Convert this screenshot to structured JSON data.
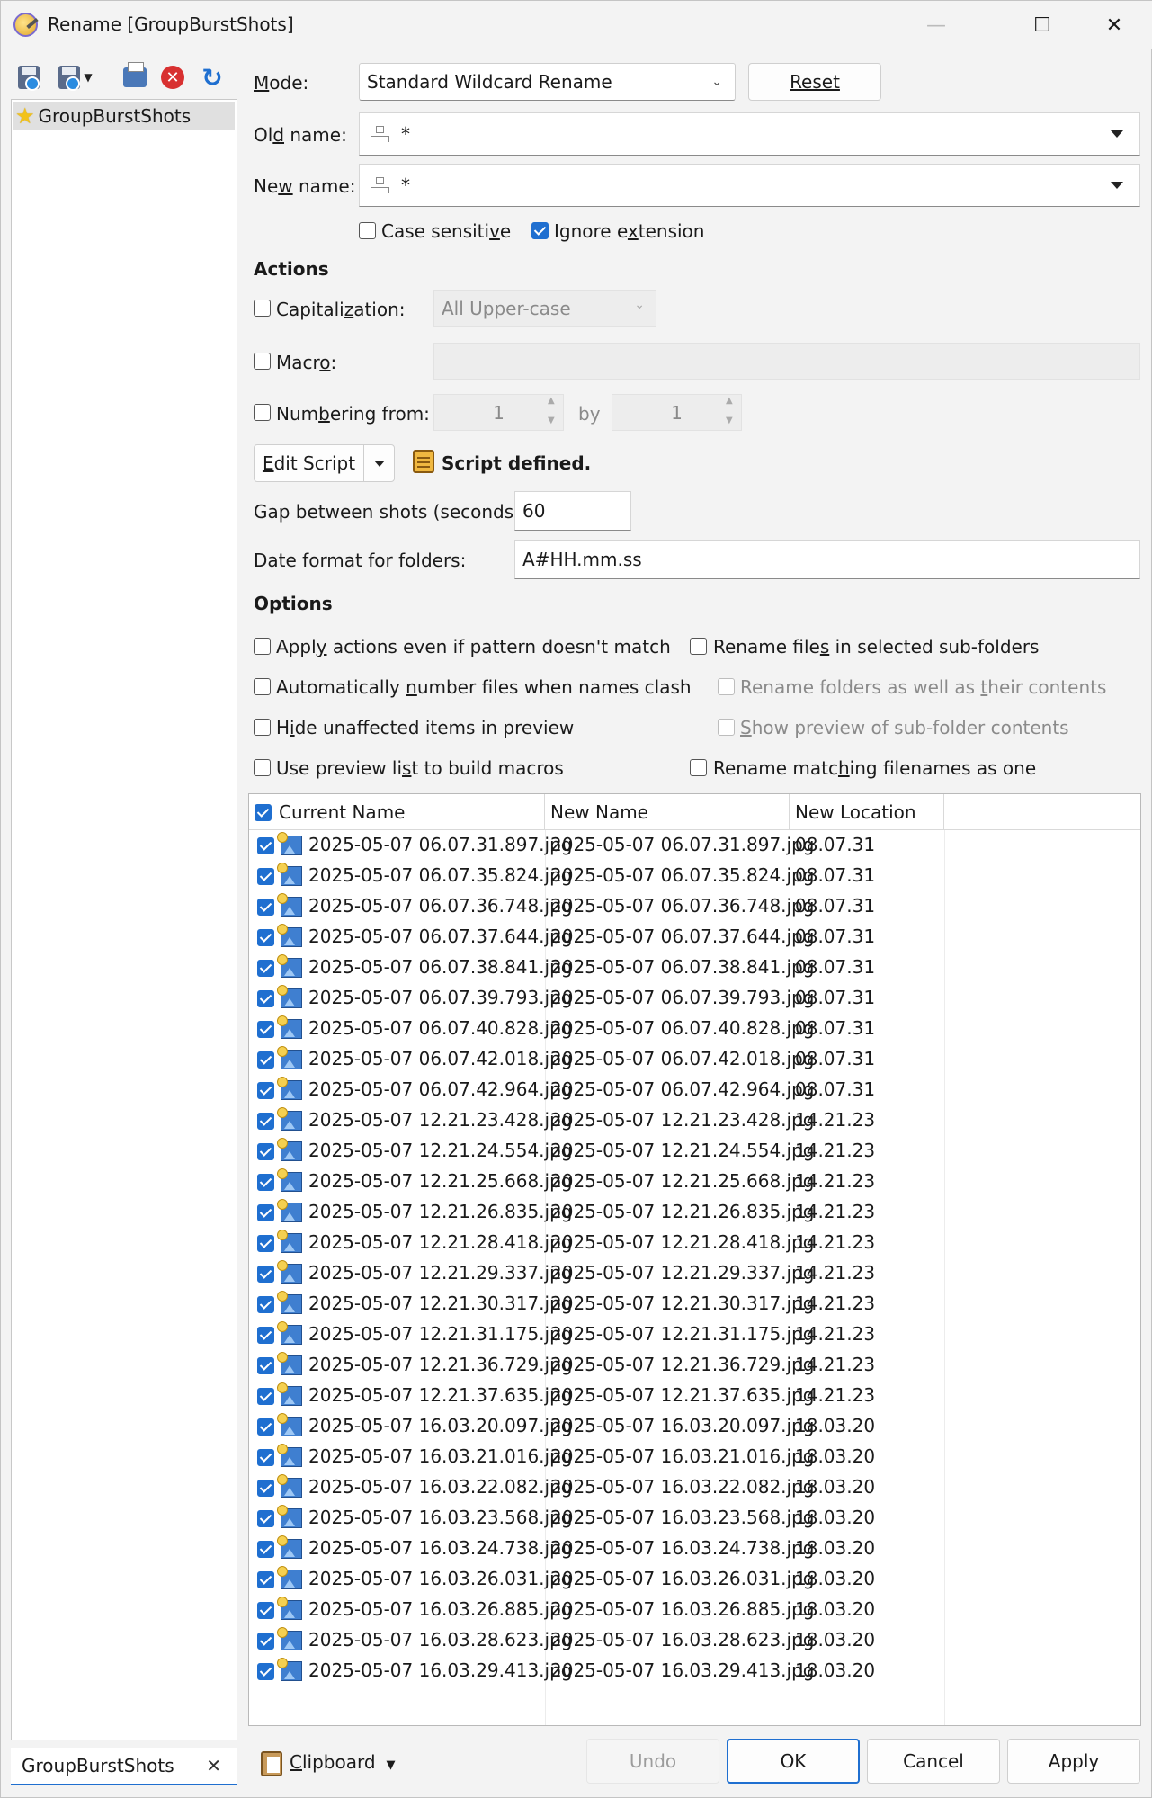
{
  "window": {
    "title": "Rename [GroupBurstShots]"
  },
  "sidebar": {
    "preset": "GroupBurstShots",
    "filter_value": "GroupBurstShots"
  },
  "mode": {
    "label_pre": "",
    "label_u": "M",
    "label_post": "ode:",
    "value": "Standard Wildcard Rename",
    "reset": "Reset"
  },
  "old_name": {
    "label_pre": "Ol",
    "label_u": "d",
    "label_post": " name:",
    "value": "*"
  },
  "new_name": {
    "label_pre": "Ne",
    "label_u": "w",
    "label_post": " name:",
    "value": "*"
  },
  "flags": {
    "case_pre": "Case sensiti",
    "case_u": "v",
    "case_post": "e",
    "ignore_pre": "Ignore e",
    "ignore_u": "x",
    "ignore_post": "tension"
  },
  "actions": {
    "heading": "Actions",
    "cap_pre": "Capitali",
    "cap_u": "z",
    "cap_post": "ation:",
    "cap_value": "All Upper-case",
    "macro_pre": "Macr",
    "macro_u": "o",
    "macro_post": ":",
    "num_pre": "Num",
    "num_u": "b",
    "num_post": "ering from:",
    "num_from": "1",
    "num_by_label": "by",
    "num_by": "1",
    "edit_script_u": "E",
    "edit_script_post": "dit Script",
    "script_status": "Script defined."
  },
  "script_fields": {
    "gap_label": "Gap between shots (seconds):",
    "gap_value": "60",
    "date_label": "Date format for folders:",
    "date_value": "A#HH.mm.ss"
  },
  "options": {
    "heading": "Options",
    "o1_pre": "Appl",
    "o1_u": "y",
    "o1_post": " actions even if pattern doesn't match",
    "o2_pre": "Automatically ",
    "o2_u": "n",
    "o2_post": "umber files when names clash",
    "o3_pre": "H",
    "o3_u": "i",
    "o3_post": "de unaffected items in preview",
    "o4_pre": "Use preview li",
    "o4_u": "s",
    "o4_post": "t to build macros",
    "o5_pre": "Rename file",
    "o5_u": "s",
    "o5_post": " in selected sub-folders",
    "o6_pre": "Rename folders as well as ",
    "o6_u": "t",
    "o6_post": "heir contents",
    "o7_pre": "",
    "o7_u": "S",
    "o7_post": "how preview of sub-folder contents",
    "o8_pre": "Rename matc",
    "o8_u": "h",
    "o8_post": "ing filenames as one"
  },
  "preview": {
    "columns": [
      "Current Name",
      "New Name",
      "New Location"
    ],
    "rows": [
      [
        "2025-05-07 06.07.31.897.jpg",
        "2025-05-07 06.07.31.897.jpg",
        "08.07.31"
      ],
      [
        "2025-05-07 06.07.35.824.jpg",
        "2025-05-07 06.07.35.824.jpg",
        "08.07.31"
      ],
      [
        "2025-05-07 06.07.36.748.jpg",
        "2025-05-07 06.07.36.748.jpg",
        "08.07.31"
      ],
      [
        "2025-05-07 06.07.37.644.jpg",
        "2025-05-07 06.07.37.644.jpg",
        "08.07.31"
      ],
      [
        "2025-05-07 06.07.38.841.jpg",
        "2025-05-07 06.07.38.841.jpg",
        "08.07.31"
      ],
      [
        "2025-05-07 06.07.39.793.jpg",
        "2025-05-07 06.07.39.793.jpg",
        "08.07.31"
      ],
      [
        "2025-05-07 06.07.40.828.jpg",
        "2025-05-07 06.07.40.828.jpg",
        "08.07.31"
      ],
      [
        "2025-05-07 06.07.42.018.jpg",
        "2025-05-07 06.07.42.018.jpg",
        "08.07.31"
      ],
      [
        "2025-05-07 06.07.42.964.jpg",
        "2025-05-07 06.07.42.964.jpg",
        "08.07.31"
      ],
      [
        "2025-05-07 12.21.23.428.jpg",
        "2025-05-07 12.21.23.428.jpg",
        "14.21.23"
      ],
      [
        "2025-05-07 12.21.24.554.jpg",
        "2025-05-07 12.21.24.554.jpg",
        "14.21.23"
      ],
      [
        "2025-05-07 12.21.25.668.jpg",
        "2025-05-07 12.21.25.668.jpg",
        "14.21.23"
      ],
      [
        "2025-05-07 12.21.26.835.jpg",
        "2025-05-07 12.21.26.835.jpg",
        "14.21.23"
      ],
      [
        "2025-05-07 12.21.28.418.jpg",
        "2025-05-07 12.21.28.418.jpg",
        "14.21.23"
      ],
      [
        "2025-05-07 12.21.29.337.jpg",
        "2025-05-07 12.21.29.337.jpg",
        "14.21.23"
      ],
      [
        "2025-05-07 12.21.30.317.jpg",
        "2025-05-07 12.21.30.317.jpg",
        "14.21.23"
      ],
      [
        "2025-05-07 12.21.31.175.jpg",
        "2025-05-07 12.21.31.175.jpg",
        "14.21.23"
      ],
      [
        "2025-05-07 12.21.36.729.jpg",
        "2025-05-07 12.21.36.729.jpg",
        "14.21.23"
      ],
      [
        "2025-05-07 12.21.37.635.jpg",
        "2025-05-07 12.21.37.635.jpg",
        "14.21.23"
      ],
      [
        "2025-05-07 16.03.20.097.jpg",
        "2025-05-07 16.03.20.097.jpg",
        "18.03.20"
      ],
      [
        "2025-05-07 16.03.21.016.jpg",
        "2025-05-07 16.03.21.016.jpg",
        "18.03.20"
      ],
      [
        "2025-05-07 16.03.22.082.jpg",
        "2025-05-07 16.03.22.082.jpg",
        "18.03.20"
      ],
      [
        "2025-05-07 16.03.23.568.jpg",
        "2025-05-07 16.03.23.568.jpg",
        "18.03.20"
      ],
      [
        "2025-05-07 16.03.24.738.jpg",
        "2025-05-07 16.03.24.738.jpg",
        "18.03.20"
      ],
      [
        "2025-05-07 16.03.26.031.jpg",
        "2025-05-07 16.03.26.031.jpg",
        "18.03.20"
      ],
      [
        "2025-05-07 16.03.26.885.jpg",
        "2025-05-07 16.03.26.885.jpg",
        "18.03.20"
      ],
      [
        "2025-05-07 16.03.28.623.jpg",
        "2025-05-07 16.03.28.623.jpg",
        "18.03.20"
      ],
      [
        "2025-05-07 16.03.29.413.jpg",
        "2025-05-07 16.03.29.413.jpg",
        "18.03.20"
      ]
    ]
  },
  "footer": {
    "clip_u": "C",
    "clip_post": "lipboard",
    "undo": "Undo",
    "ok": "OK",
    "cancel": "Cancel",
    "apply": "Apply"
  },
  "colors": {
    "accent": "#1f6fd0"
  }
}
